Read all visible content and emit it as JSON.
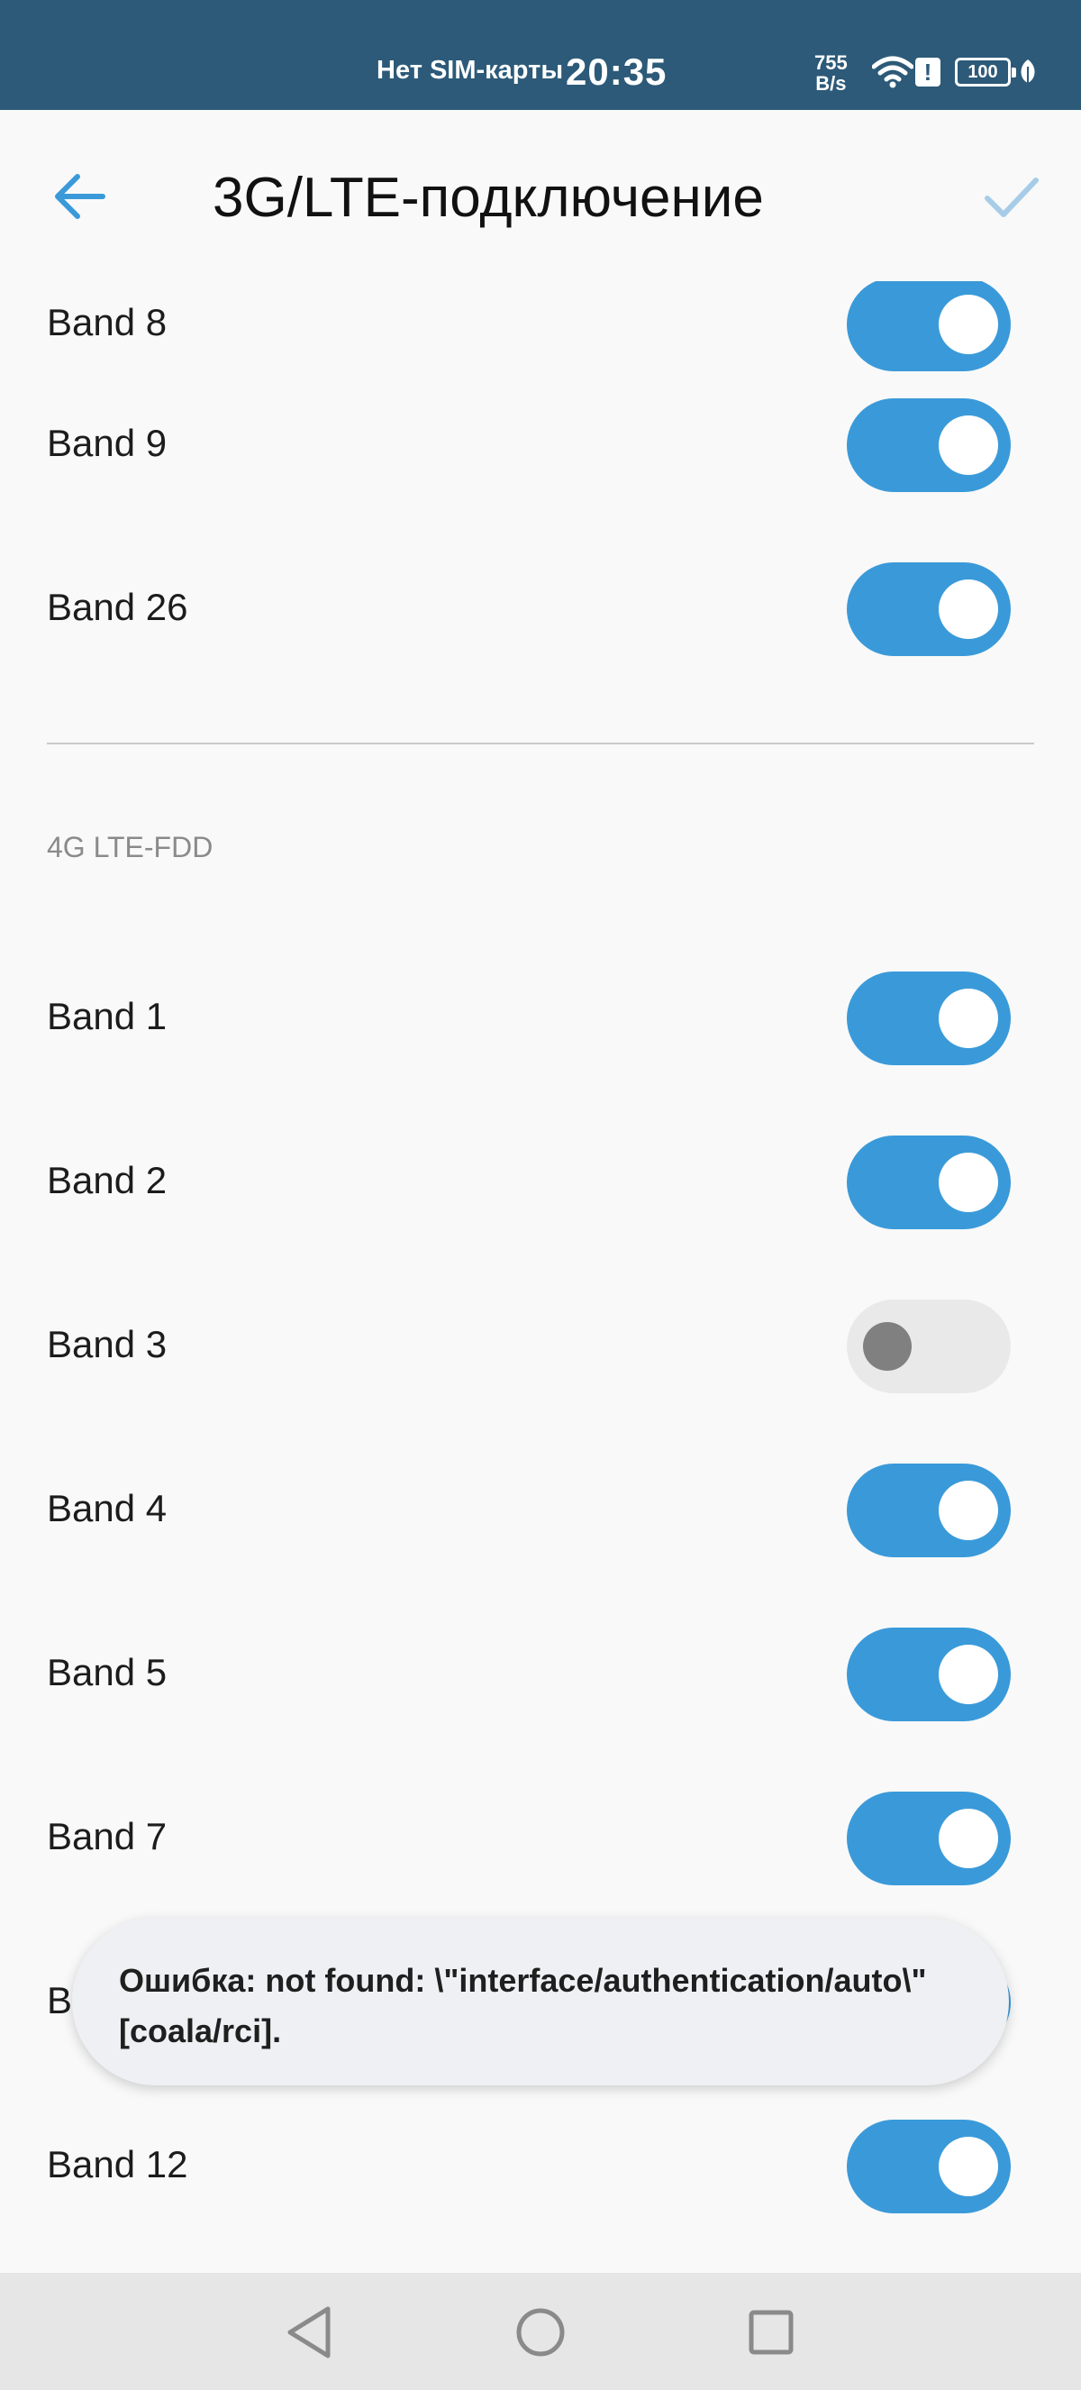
{
  "status_bar": {
    "carrier": "Нет SIM-карты",
    "time": "20:35",
    "speed_value": "755",
    "speed_unit": "B/s",
    "battery": "100",
    "icons": [
      "wifi-icon",
      "alert-icon",
      "battery-icon",
      "leaf-icon"
    ]
  },
  "header": {
    "title": "3G/LTE-подключение",
    "back_icon": "arrow-left-icon",
    "confirm_icon": "checkmark-icon"
  },
  "sections": [
    {
      "header": "",
      "bands": [
        {
          "label": "Band 8",
          "enabled": true
        },
        {
          "label": "Band 9",
          "enabled": true
        },
        {
          "label": "Band 26",
          "enabled": true
        }
      ]
    },
    {
      "header": "4G LTE-FDD",
      "bands": [
        {
          "label": "Band 1",
          "enabled": true
        },
        {
          "label": "Band 2",
          "enabled": true
        },
        {
          "label": "Band 3",
          "enabled": false
        },
        {
          "label": "Band 4",
          "enabled": true
        },
        {
          "label": "Band 5",
          "enabled": true
        },
        {
          "label": "Band 7",
          "enabled": true
        },
        {
          "label": "B",
          "enabled": true
        },
        {
          "label": "Band 12",
          "enabled": true
        }
      ]
    }
  ],
  "toast": {
    "message": "Ошибка: not found: \\\"interface/authentication/auto\\\" [coala/rci]."
  },
  "nav_bar": {
    "buttons": [
      "back-triangle-icon",
      "home-circle-icon",
      "recents-square-icon"
    ]
  },
  "colors": {
    "status_bar_bg": "#2c5a78",
    "accent": "#3a9ad9",
    "toggle_off_track": "#e9e9e9",
    "toggle_off_knob": "#808080",
    "background": "#f9f9f9"
  }
}
